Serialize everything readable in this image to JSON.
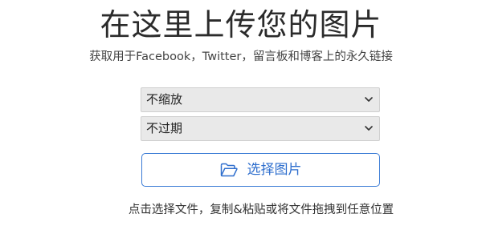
{
  "header": {
    "title": "在这里上传您的图片",
    "subtitle": "获取用于Facebook，Twitter，留言板和博客上的永久链接"
  },
  "form": {
    "resize_select": {
      "selected": "不缩放"
    },
    "expiry_select": {
      "selected": "不过期"
    },
    "upload_button": {
      "label": "选择图片",
      "icon": "folder-open-icon"
    },
    "hint": "点击选择文件，复制&粘贴或将文件拖拽到任意位置"
  },
  "colors": {
    "accent": "#2f6fce",
    "select_bg": "#e9e9e9",
    "text": "#333333"
  }
}
